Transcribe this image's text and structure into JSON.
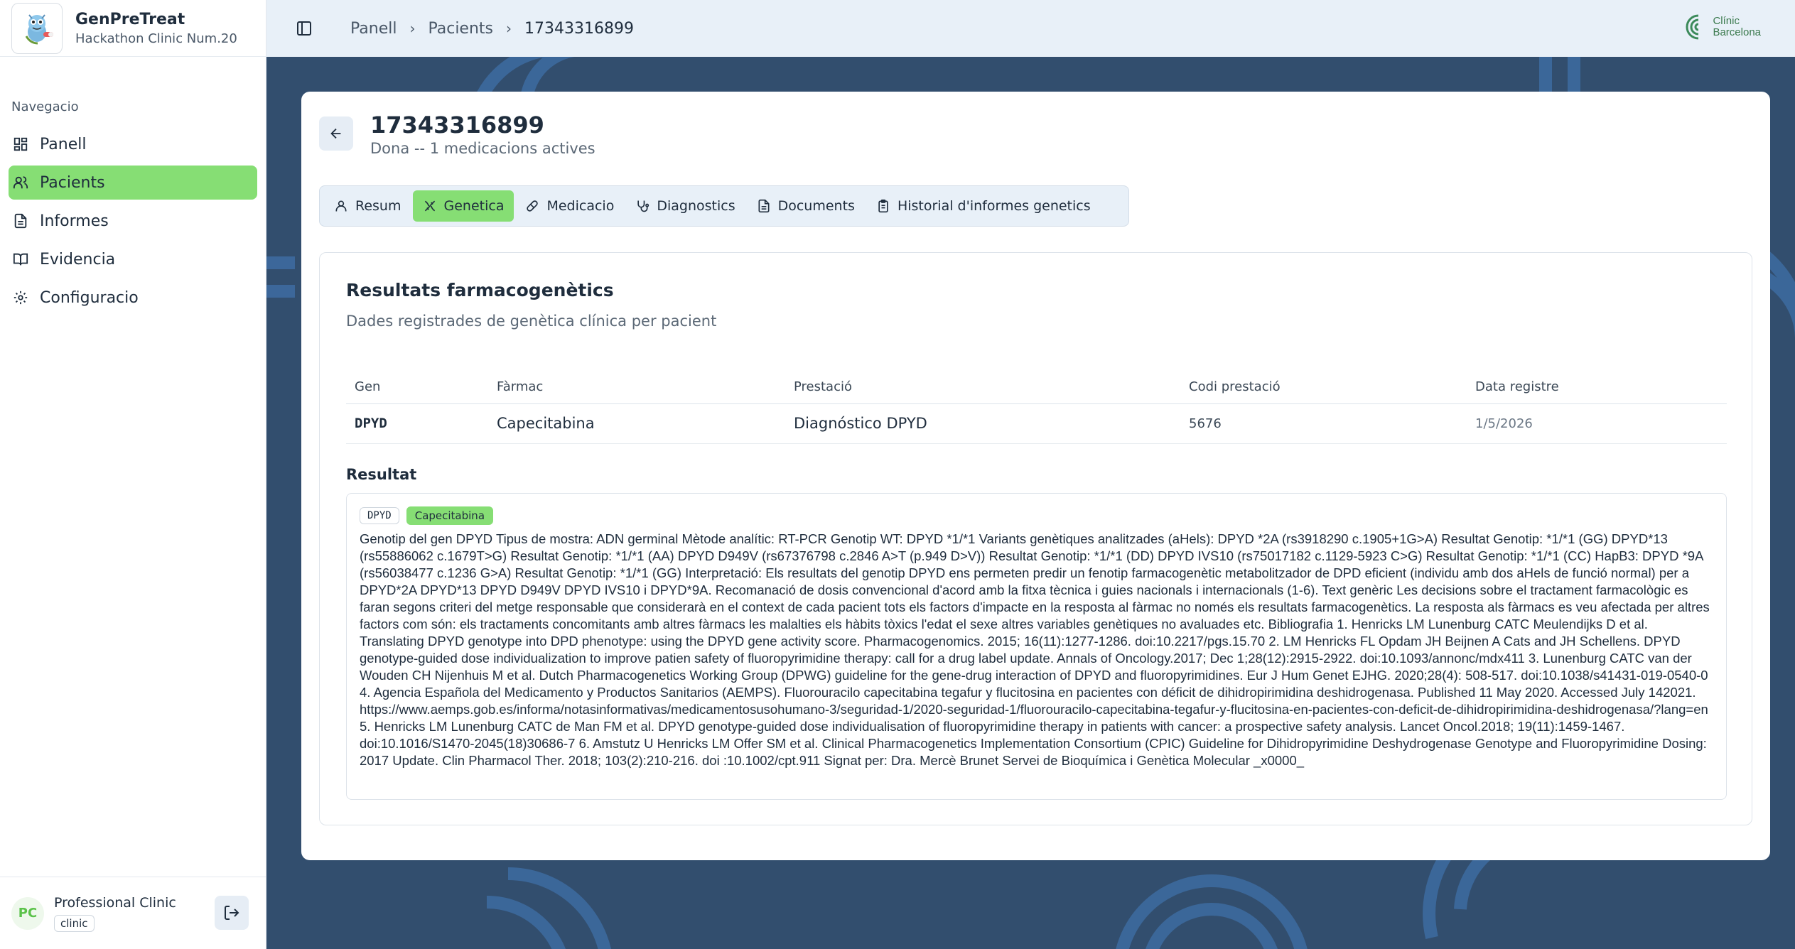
{
  "brand": {
    "name": "GenPreTreat",
    "subtitle": "Hackathon Clinic Num.20"
  },
  "nav": {
    "heading": "Navegacio",
    "items": [
      {
        "label": "Panell",
        "icon": "dashboard-icon"
      },
      {
        "label": "Pacients",
        "icon": "users-icon",
        "active": true
      },
      {
        "label": "Informes",
        "icon": "file-icon"
      },
      {
        "label": "Evidencia",
        "icon": "book-icon"
      },
      {
        "label": "Configuracio",
        "icon": "gear-icon"
      }
    ]
  },
  "user": {
    "initials": "PC",
    "name": "Professional Clinic",
    "role": "clinic"
  },
  "breadcrumb": {
    "items": [
      "Panell",
      "Pacients",
      "17343316899"
    ]
  },
  "clinic_logo": {
    "line1": "Clínic",
    "line2": "Barcelona"
  },
  "patient": {
    "id": "17343316899",
    "subtitle": "Dona -- 1 medicacions actives"
  },
  "tabs": [
    {
      "label": "Resum",
      "icon": "user-icon"
    },
    {
      "label": "Genetica",
      "icon": "dna-icon",
      "active": true
    },
    {
      "label": "Medicacio",
      "icon": "pill-icon"
    },
    {
      "label": "Diagnostics",
      "icon": "stethoscope-icon"
    },
    {
      "label": "Documents",
      "icon": "document-icon"
    },
    {
      "label": "Historial d'informes genetics",
      "icon": "clipboard-icon"
    }
  ],
  "results": {
    "title": "Resultats farmacogenètics",
    "subtitle": "Dades registrades de genètica clínica per pacient",
    "columns": [
      "Gen",
      "Fàrmac",
      "Prestació",
      "Codi prestació",
      "Data registre"
    ],
    "rows": [
      {
        "gene": "DPYD",
        "drug": "Capecitabina",
        "service": "Diagnóstico DPYD",
        "code": "5676",
        "date": "1/5/2026"
      }
    ],
    "result_label": "Resultat",
    "result_badge_gene": "DPYD",
    "result_badge_drug": "Capecitabina",
    "result_text": "Genotip del gen DPYD Tipus de mostra: ADN germinal Mètode analític: RT-PCR Genotip WT: DPYD *1/*1 Variants genètiques analitzades (aHels): DPYD *2A (rs3918290 c.1905+1G>A) Resultat Genotip: *1/*1 (GG) DPYD*13 (rs55886062 c.1679T>G) Resultat Genotip: *1/*1 (AA) DPYD D949V (rs67376798 c.2846 A>T (p.949 D>V)) Resultat Genotip: *1/*1 (DD) DPYD IVS10 (rs75017182 c.1129-5923 C>G) Resultat Genotip: *1/*1 (CC) HapB3: DPYD *9A (rs56038477 c.1236 G>A) Resultat Genotip: *1/*1 (GG) Interpretació: Els resultats del genotip DPYD ens permeten predir un fenotip farmacogenètic metabolitzador de DPD eficient (individu amb dos aHels de funció normal) per a DPYD*2A DPYD*13 DPYD D949V DPYD IVS10 i DPYD*9A. Recomanació de dosis convencional d'acord amb la fitxa tècnica i guies nacionals i internacionals (1-6). Text genèric Les decisions sobre el tractament farmacològic es faran segons criteri del metge responsable que considerarà en el context de cada pacient tots els factors d'impacte en la resposta al fàrmac no només els resultats farmacogenètics. La resposta als fàrmacs es veu afectada per altres factors com són: els tractaments concomitants amb altres fàrmacs les malalties els hàbits tòxics l'edat el sexe altres variables genètiques no avaluades etc. Bibliografia 1. Henricks LM Lunenburg CATC Meulendijks D et al. Translating DPYD genotype into DPD phenotype: using the DPYD gene activity score. Pharmacogenomics.  2015; 16(11):1277-1286. doi:10.2217/pgs.15.70 2. LM Henricks FL Opdam JH Beijnen A Cats and JH Schellens. DPYD genotype-guided dose individualization to improve patien safety of fluoropyrimidine therapy: call for a drug label update. Annals of Oncology.2017; Dec 1;28(12):2915-2922. doi:10.1093/annonc/mdx411   3. Lunenburg CATC van der Wouden CH Nijenhuis M et al. Dutch Pharmacogenetics Working Group (DPWG) guideline for the gene-drug interaction of DPYD and fluoropyrimidines. Eur J Hum Genet EJHG. 2020;28(4): 508-517. doi:10.1038/s41431-019-0540-0 4. Agencia Española del  Medicamento y Productos Sanitarios (AEMPS). Fluorouracilo capecitabina tegafur y flucitosina en pacientes con déficit de dihidropirimidina deshidrogenasa. Published 11 May 2020. Accessed July 142021. https://www.aemps.gob.es/informa/notasinformativas/medicamentosusohumano-3/seguridad-1/2020-seguridad-1/fluorouracilo-capecitabina-tegafur-y-flucitosina-en-pacientes-con-deficit-de-dihidropirimidina-deshidrogenasa/?lang=en 5. Henricks LM Lunenburg CATC de Man FM et al. DPYD genotype-guided dose individualisation of fluoropyrimidine therapy in patients with cancer: a prospective safety analysis. Lancet Oncol.2018; 19(11):1459-1467. doi:10.1016/S1470-2045(18)30686-7   6. Amstutz U Henricks LM Offer SM et al. Clinical Pharmacogenetics Implementation Consortium (CPIC) Guideline for Dihidropyrimidine Deshydrogenase Genotype and Fluoropyrimidine Dosing: 2017 Update. Clin Pharmacol Ther. 2018; 103(2):210-216. doi :10.1002/cpt.911 Signat per: Dra. Mercè Brunet Servei de Bioquímica i Genètica Molecular _x0000_"
  },
  "colors": {
    "accent": "#86de74",
    "main_bg": "#324e6e",
    "topbar_bg": "#e8f0f8"
  }
}
